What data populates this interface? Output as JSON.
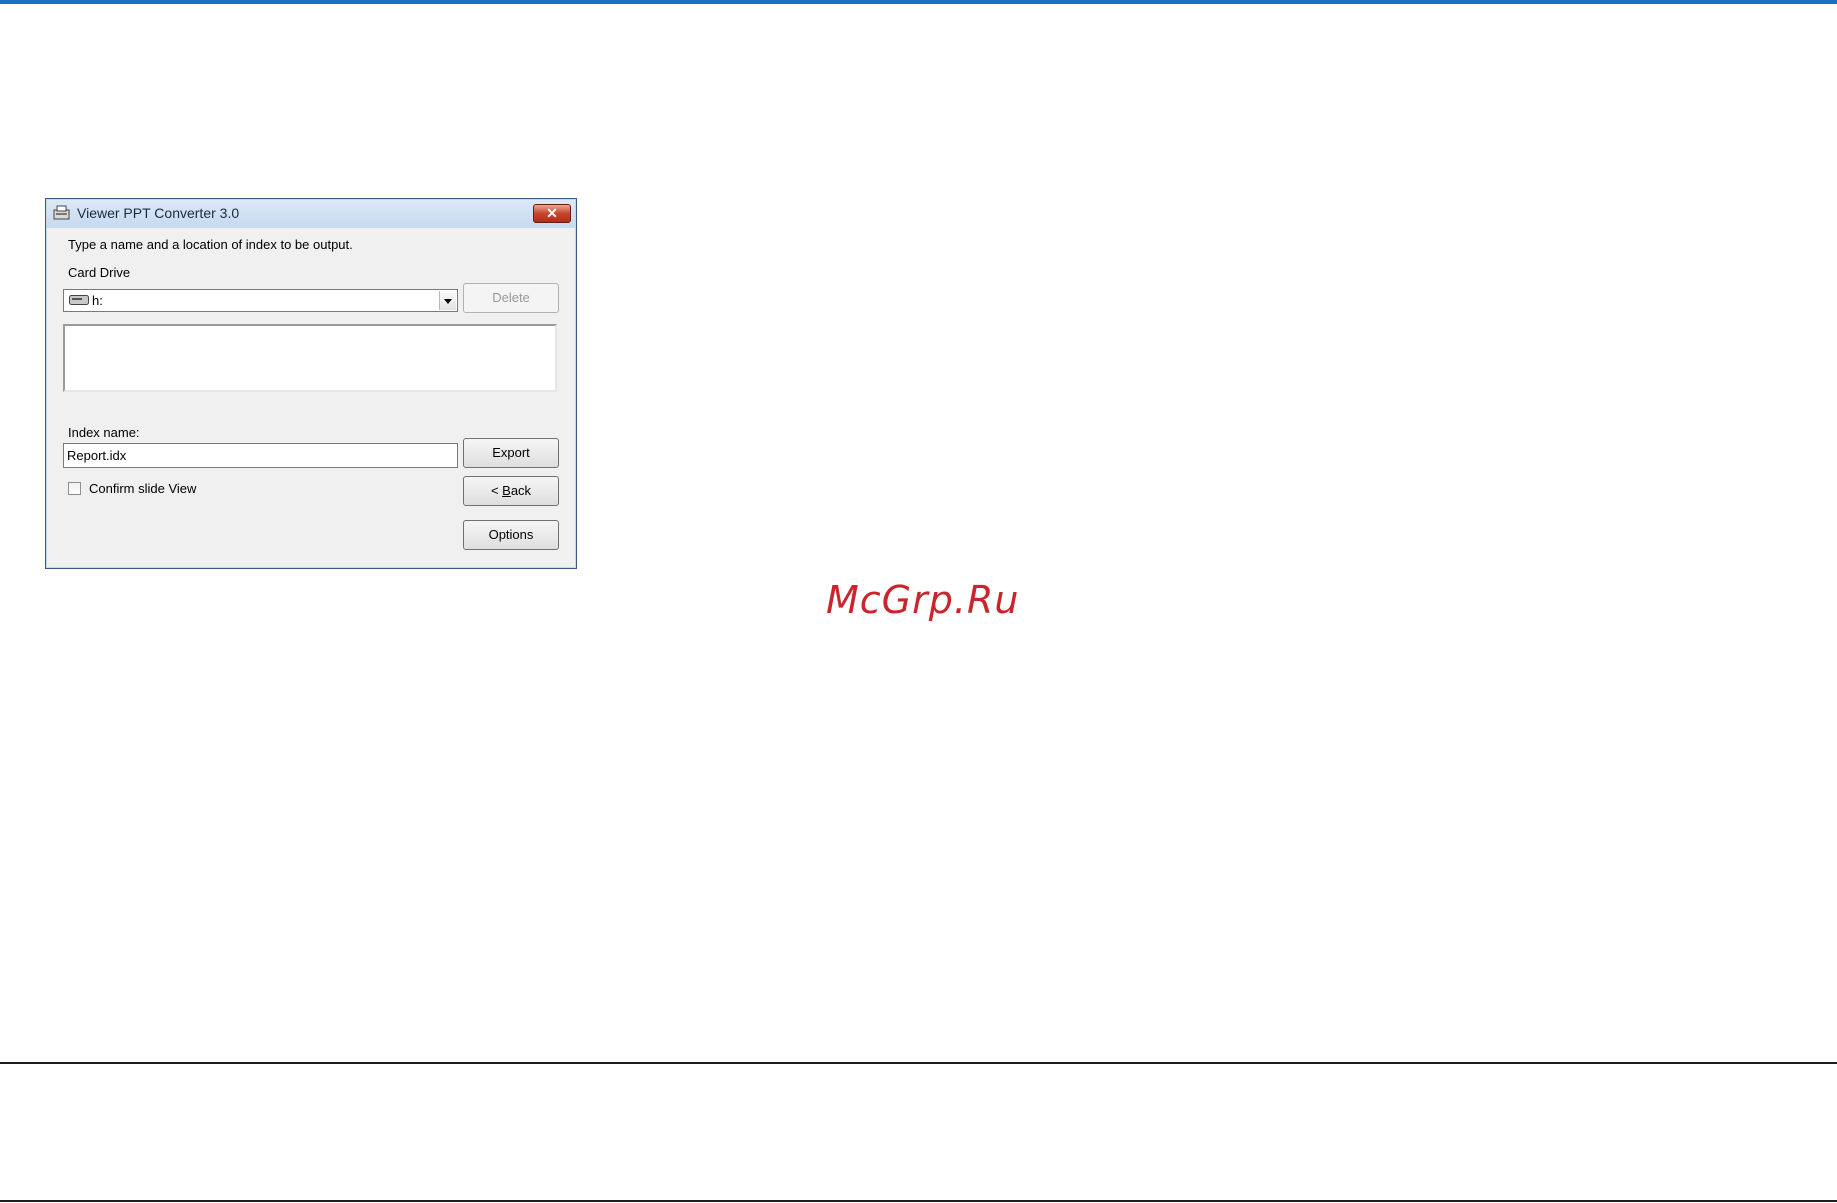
{
  "dialog": {
    "title": "Viewer PPT Converter 3.0",
    "close_label": "✕",
    "instruction": "Type a name and a location of index to be output.",
    "card_drive_label": "Card Drive",
    "card_drive_value": "h:",
    "delete_label": "Delete",
    "index_name_label": "Index name:",
    "index_name_value": "Report.idx",
    "export_label": "Export",
    "confirm_label": "Confirm slide View",
    "confirm_checked": false,
    "back_prefix": "< ",
    "back_accel": "B",
    "back_rest": "ack",
    "options_label": "Options"
  },
  "watermark": "McGrp.Ru",
  "colors": {
    "top_rule": "#1a6fc0",
    "watermark": "#c8262c",
    "dialog_bg": "#f0f0f0"
  },
  "icons": [
    "app-icon",
    "close-icon",
    "drive-icon",
    "chevron-down-icon"
  ]
}
